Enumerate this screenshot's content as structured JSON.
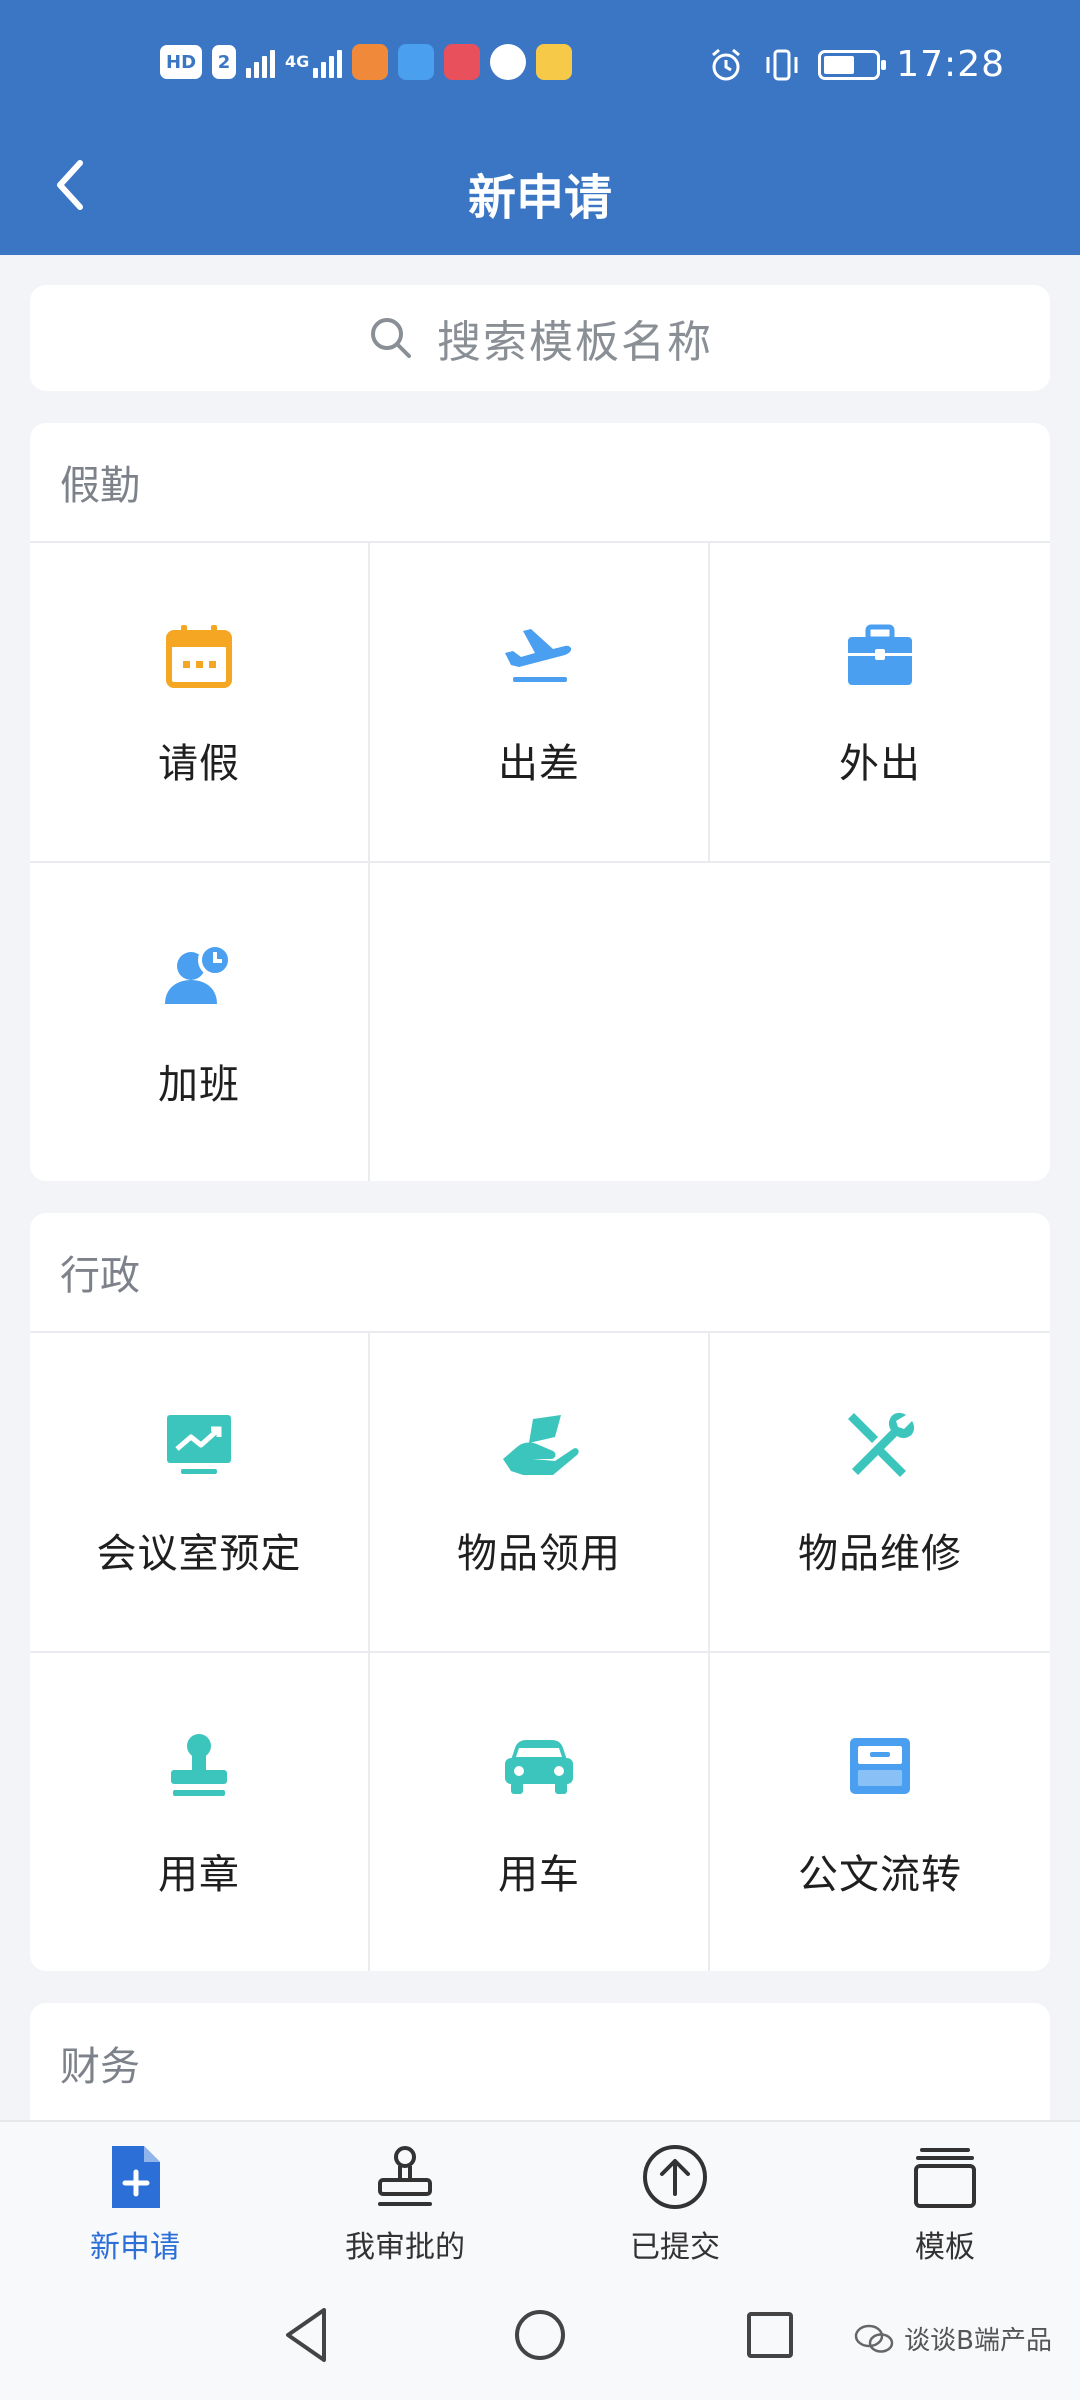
{
  "status_bar": {
    "hd_label": "HD",
    "sim_label": "2",
    "network_label": "4G",
    "time": "17:28",
    "battery_level": 0.6,
    "app_icon_colors": [
      "#f08a3a",
      "#4aa0ef",
      "#e8505b",
      "#ffffff",
      "#f7c948"
    ]
  },
  "header": {
    "title": "新申请",
    "bg_color": "#3b76c4"
  },
  "search": {
    "placeholder": "搜索模板名称"
  },
  "sections": [
    {
      "title": "假勤",
      "items": [
        {
          "label": "请假",
          "icon": "calendar-icon",
          "color": "#f5a623"
        },
        {
          "label": "出差",
          "icon": "airplane-icon",
          "color": "#4a9ff0"
        },
        {
          "label": "外出",
          "icon": "briefcase-icon",
          "color": "#4a9ff0"
        },
        {
          "label": "加班",
          "icon": "person-clock-icon",
          "color": "#4a9ff0"
        }
      ]
    },
    {
      "title": "行政",
      "items": [
        {
          "label": "会议室预定",
          "icon": "presentation-board-icon",
          "color": "#3cc5bd"
        },
        {
          "label": "物品领用",
          "icon": "hand-receive-icon",
          "color": "#3cc5bd"
        },
        {
          "label": "物品维修",
          "icon": "tools-icon",
          "color": "#3cc5bd"
        },
        {
          "label": "用章",
          "icon": "stamp-icon",
          "color": "#3cc5bd"
        },
        {
          "label": "用车",
          "icon": "car-icon",
          "color": "#3cc5bd"
        },
        {
          "label": "公文流转",
          "icon": "file-tray-icon",
          "color": "#4a9ff0"
        }
      ]
    },
    {
      "title": "财务"
    }
  ],
  "tabbar": {
    "tabs": [
      {
        "label": "新申请",
        "icon": "new-document-icon",
        "active": true
      },
      {
        "label": "我审批的",
        "icon": "stamp-outline-icon",
        "active": false
      },
      {
        "label": "已提交",
        "icon": "upload-circle-icon",
        "active": false
      },
      {
        "label": "模板",
        "icon": "stack-icon",
        "active": false
      }
    ],
    "active_color": "#2c6fd6"
  },
  "watermark": {
    "text": "谈谈B端产品"
  }
}
